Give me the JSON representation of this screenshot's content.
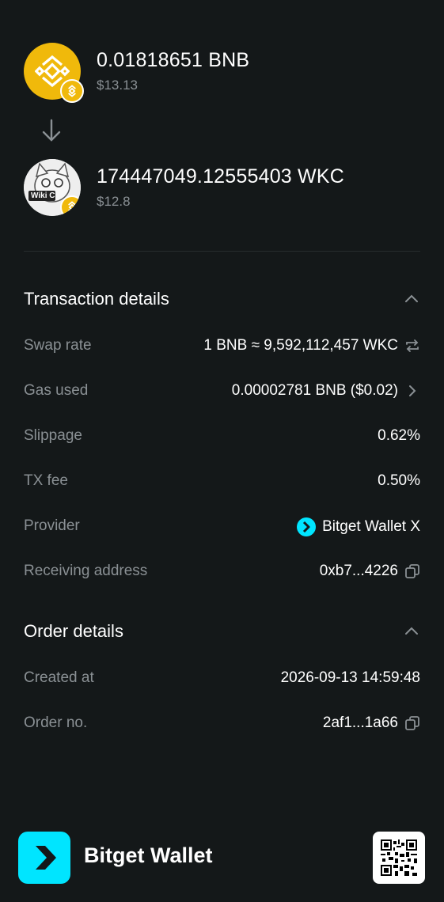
{
  "from_token": {
    "amount": "0.01818651 BNB",
    "usd": "$13.13",
    "icon": "bnb-logo-icon",
    "chain_badge": "bnb-chain-badge-icon"
  },
  "arrow_icon": "arrow-down-icon",
  "to_token": {
    "amount": "174447049.12555403 WKC",
    "usd": "$12.8",
    "icon": "wikicat-logo-icon",
    "icon_text": "Wiki C",
    "chain_badge": "bnb-chain-badge-icon"
  },
  "transaction_details": {
    "title": "Transaction details",
    "rows": [
      {
        "label": "Swap rate",
        "value": "1 BNB ≈ 9,592,112,457 WKC",
        "icon": "swap-icon"
      },
      {
        "label": "Gas used",
        "value": "0.00002781 BNB ($0.02)",
        "icon": "chevron-right-icon"
      },
      {
        "label": "Slippage",
        "value": "0.62%"
      },
      {
        "label": "TX fee",
        "value": "0.50%"
      },
      {
        "label": "Provider",
        "value": "Bitget Wallet X",
        "icon": "bitget-provider-icon"
      },
      {
        "label": "Receiving address",
        "value": "0xb7...4226",
        "icon": "copy-icon"
      }
    ]
  },
  "order_details": {
    "title": "Order details",
    "rows": [
      {
        "label": "Created at",
        "value": "2026-09-13 14:59:48"
      },
      {
        "label": "Order no.",
        "value": "2af1...1a66",
        "icon": "copy-icon"
      }
    ]
  },
  "footer": {
    "brand": "Bitget Wallet",
    "logo": "bitget-wallet-logo-icon",
    "qr": "qr-code-icon"
  },
  "colors": {
    "background": "#141819",
    "muted_text": "#8a9094",
    "bnb_yellow": "#F0B90B",
    "bitget_cyan": "#00E5FF"
  }
}
